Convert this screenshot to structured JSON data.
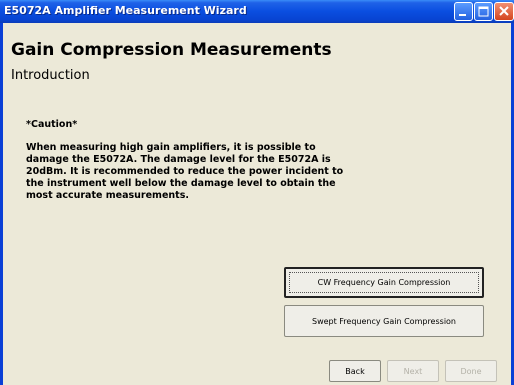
{
  "window": {
    "title": "E5072A Amplifier Measurement Wizard",
    "title_buttons": [
      "minimize",
      "maximize",
      "close"
    ]
  },
  "page": {
    "heading": "Gain Compression Measurements",
    "subheading": "Introduction"
  },
  "caution": {
    "title": "*Caution*",
    "body": "When measuring high gain amplifiers, it is possible to damage the E5072A. The damage level for the E5072A is 20dBm.  It is recommended to reduce the power incident to the instrument well below the damage level to obtain the most accurate measurements."
  },
  "options": {
    "cw_label": "CW Frequency Gain Compression",
    "swept_label": "Swept Frequency Gain Compression"
  },
  "nav": {
    "back_label": "Back",
    "next_label": "Next",
    "done_label": "Done",
    "next_enabled": false,
    "done_enabled": false
  },
  "colors": {
    "titlebar": "#0a4ee0",
    "client_bg": "#ece9d8"
  }
}
